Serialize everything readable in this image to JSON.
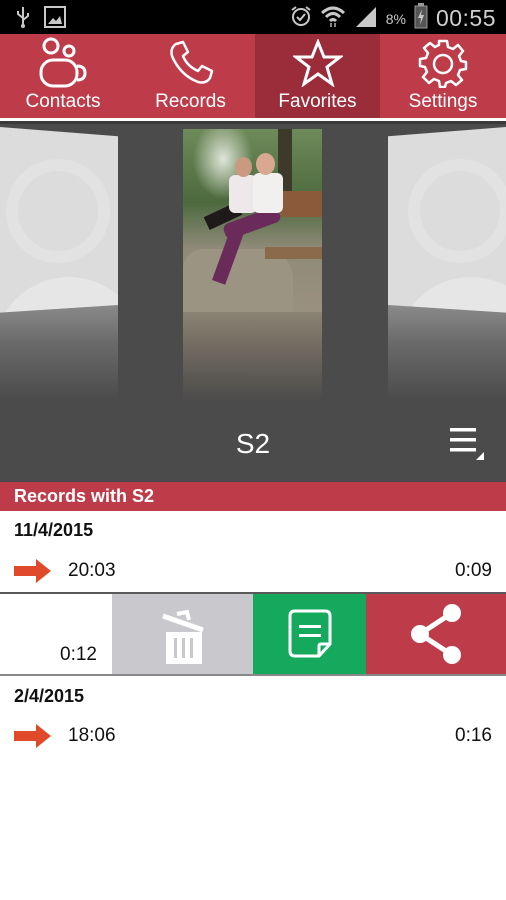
{
  "status_bar": {
    "left_icons": [
      "usb-icon",
      "image-icon"
    ],
    "right_icons": [
      "alarm-icon",
      "wifi-icon",
      "signal-icon"
    ],
    "battery_percent": "8%",
    "time": "00:55"
  },
  "tabs": [
    {
      "label": "Contacts",
      "icon": "contacts-icon",
      "active": false
    },
    {
      "label": "Records",
      "icon": "phone-icon",
      "active": false
    },
    {
      "label": "Favorites",
      "icon": "star-icon",
      "active": true
    },
    {
      "label": "Settings",
      "icon": "gear-icon",
      "active": false
    }
  ],
  "carousel": {
    "contact_name": "S2",
    "menu_icon": "menu-icon"
  },
  "records": {
    "header": "Records with S2",
    "groups": [
      {
        "date": "11/4/2015",
        "items": [
          {
            "direction": "outgoing",
            "time": "20:03",
            "duration": "0:09"
          },
          {
            "direction": "outgoing",
            "time": "",
            "duration": "0:12",
            "swiped": true
          }
        ]
      },
      {
        "date": "2/4/2015",
        "items": [
          {
            "direction": "outgoing",
            "time": "18:06",
            "duration": "0:16"
          }
        ]
      }
    ],
    "swipe_actions": [
      {
        "name": "delete",
        "icon": "trash-icon",
        "color": "#c9c9cd"
      },
      {
        "name": "note",
        "icon": "note-icon",
        "color": "#14a95c"
      },
      {
        "name": "share",
        "icon": "share-icon",
        "color": "#be3c4a"
      }
    ]
  },
  "colors": {
    "accent": "#be3c4a",
    "tab_active": "#9b2c39",
    "arrow": "#e04a2a",
    "carousel_bg": "#4b4b4b"
  }
}
